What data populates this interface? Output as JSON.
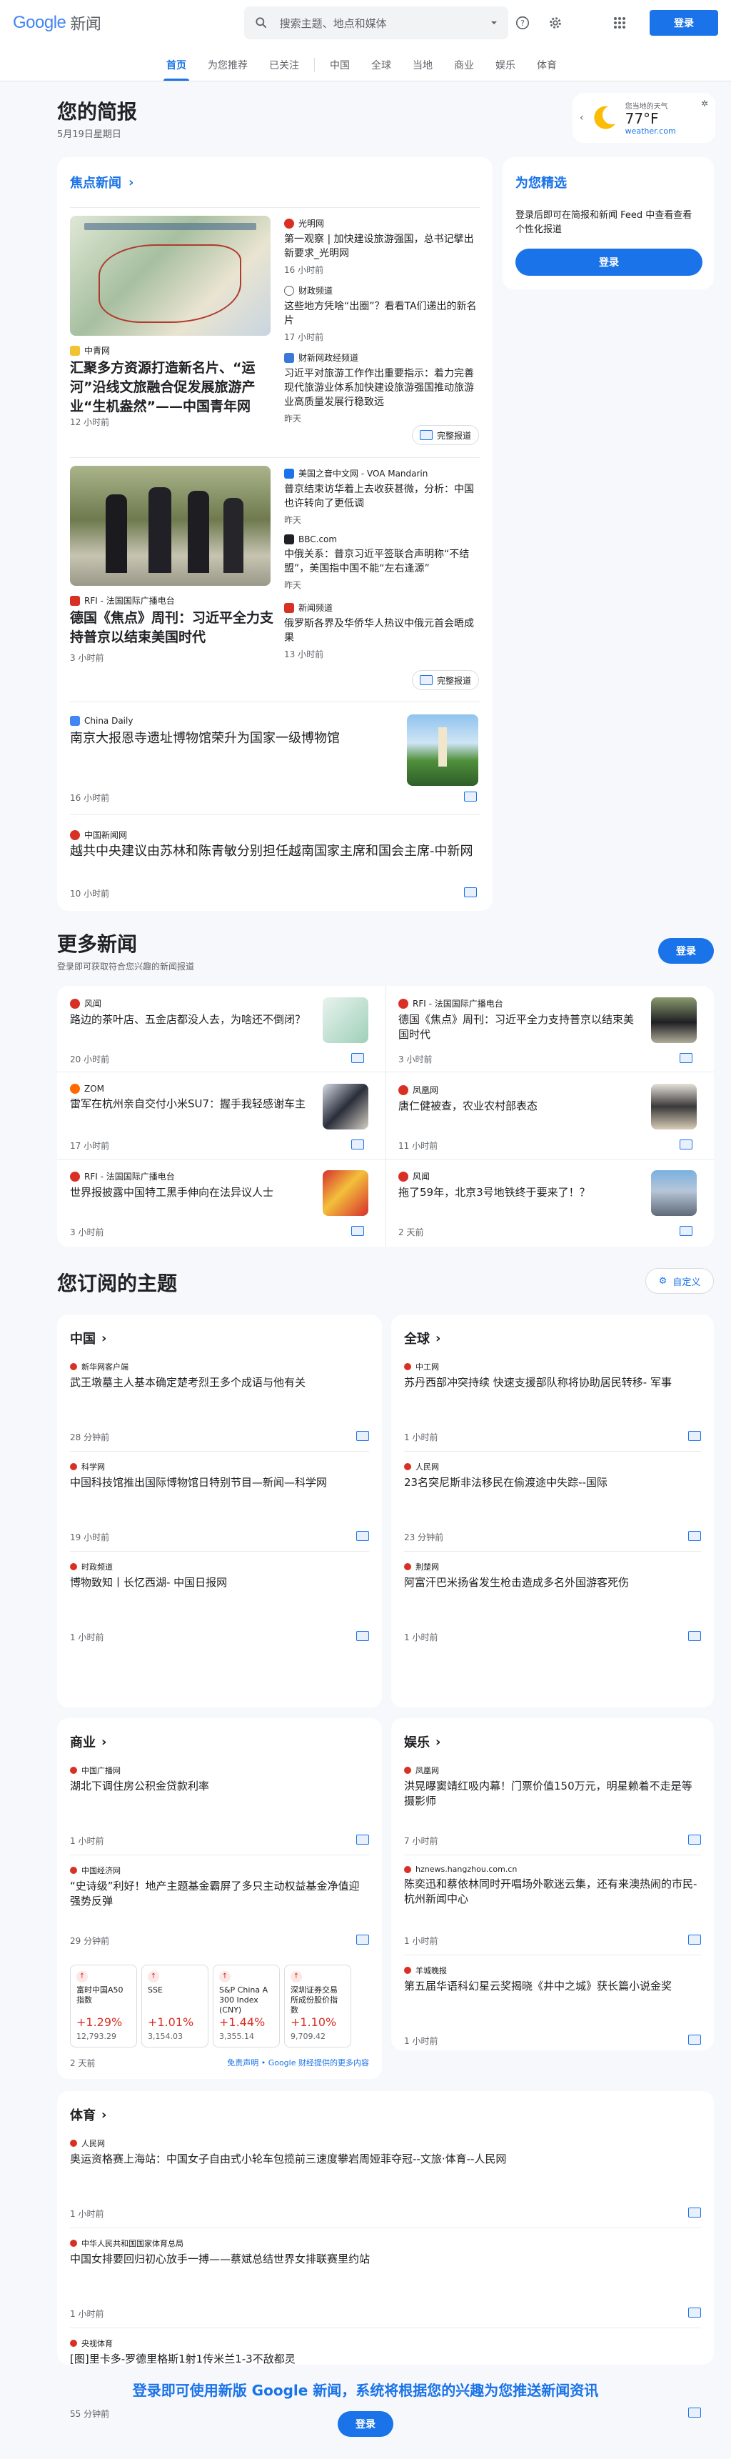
{
  "header": {
    "logo_google": "Google",
    "logo_news": "新闻",
    "search_placeholder": "搜索主题、地点和媒体",
    "signin": "登录"
  },
  "nav": {
    "tabs": [
      "首页",
      "为您推荐",
      "已关注",
      "中国",
      "全球",
      "当地",
      "商业",
      "娱乐",
      "体育"
    ]
  },
  "briefing": {
    "title": "您的简报",
    "date": "5月19日星期日",
    "weather_label": "您当地的天气",
    "temp": "77°F",
    "weather_source": "weather.com"
  },
  "headlines": {
    "title": "焦点新闻",
    "full_coverage": "完整报道",
    "cluster1": {
      "main_source": "中青网",
      "main_title": "汇聚多方资源打造新名片、“运河”沿线文旅融合促发展旅游产业“生机盎然”——中国青年网",
      "main_time": "12 小时前",
      "side": [
        {
          "source": "光明网",
          "title": "第一观察 | 加快建设旅游强国，总书记擘出新要求_光明网",
          "time": "16 小时前"
        },
        {
          "source": "财政频道",
          "title": "这些地方凭啥“出圈”？看看TA们递出的新名片",
          "time": "17 小时前"
        },
        {
          "source": "财新网政经频道",
          "title": "习近平对旅游工作作出重要指示：着力完善现代旅游业体系加快建设旅游强国推动旅游业高质量发展行稳致远",
          "time": "昨天"
        }
      ]
    },
    "cluster2": {
      "main_source": "RFI - 法国国际广播电台",
      "main_title": "德国《焦点》周刊：习近平全力支持普京以结束美国时代",
      "main_time": "3 小时前",
      "side": [
        {
          "source": "美国之音中文网 - VOA Mandarin",
          "title": "普京结束访华着上去收获甚微，分析：中国也许转向了更低调",
          "time": "昨天"
        },
        {
          "source": "BBC.com",
          "title": "中俄关系：普京习近平签联合声明称“不结盟”，美国指中国不能“左右逢源”",
          "time": "昨天"
        },
        {
          "source": "新闻频道",
          "title": "俄罗斯各界及华侨华人热议中俄元首会晤成果",
          "time": "13 小时前"
        }
      ]
    },
    "single1": {
      "source": "China Daily",
      "title": "南京大报恩寺遗址博物馆荣升为国家一级博物馆",
      "time": "16 小时前"
    },
    "single2": {
      "source": "中国新闻网",
      "title": "越共中央建议由苏林和陈青敏分别担任越南国家主席和国会主席-中新网",
      "time": "10 小时前"
    }
  },
  "for_you": {
    "title": "为您精选",
    "desc": "登录后即可在简报和新闻 Feed 中查看查看个性化报道",
    "signin": "登录"
  },
  "more": {
    "title": "更多新闻",
    "desc": "登录即可获取符合您兴趣的新闻报道",
    "signin": "登录",
    "items": [
      {
        "source": "风闻",
        "title": "路边的茶叶店、五金店都没人去，为啥还不倒闭？",
        "time": "20 小时前"
      },
      {
        "source": "RFI - 法国国际广播电台",
        "title": "德国《焦点》周刊：习近平全力支持普京以结束美国时代",
        "time": "3 小时前"
      },
      {
        "source": "ZOM",
        "title": "雷军在杭州亲自交付小米SU7：握手我轻感谢车主",
        "time": "17 小时前"
      },
      {
        "source": "凤凰网",
        "title": "唐仁健被查，农业农村部表态",
        "time": "11 小时前"
      },
      {
        "source": "RFI - 法国国际广播电台",
        "title": "世界报披露中国特工黑手伸向在法异议人士",
        "time": "3 小时前"
      },
      {
        "source": "风闻",
        "title": "拖了59年，北京3号地铁终于要来了！？",
        "time": "2 天前"
      }
    ]
  },
  "topics": {
    "title": "您订阅的主题",
    "customize": "自定义",
    "china": {
      "title": "中国",
      "stories": [
        {
          "source": "新华网客户端",
          "title": "武王墩墓主人基本确定楚考烈王多个成语与他有关",
          "time": "28 分钟前"
        },
        {
          "source": "科学网",
          "title": "中国科技馆推出国际博物馆日特别节目—新闻—科学网",
          "time": "19 小时前"
        },
        {
          "source": "时政频道",
          "title": "博物致知丨长忆西湖- 中国日报网",
          "time": "1 小时前"
        }
      ]
    },
    "global": {
      "title": "全球",
      "stories": [
        {
          "source": "中工网",
          "title": "苏丹西部冲突持续 快速支援部队称将协助居民转移- 军事",
          "time": "1 小时前"
        },
        {
          "source": "人民网",
          "title": "23名突尼斯非法移民在偷渡途中失踪--国际",
          "time": "23 分钟前"
        },
        {
          "source": "荆楚网",
          "title": "阿富汗巴米扬省发生枪击造成多名外国游客死伤",
          "time": "1 小时前"
        }
      ]
    },
    "business": {
      "title": "商业",
      "stories": [
        {
          "source": "中国广播网",
          "title": "湖北下调住房公积金贷款利率",
          "time": "1 小时前"
        },
        {
          "source": "中国经济网",
          "title": "“史诗级”利好！地产主题基金霸屏了多只主动权益基金净值迎强势反弹",
          "time": "29 分钟前"
        }
      ],
      "stocks": [
        {
          "name": "富时中国A50指数",
          "pct": "+1.29%",
          "val": "12,793.29"
        },
        {
          "name": "SSE",
          "pct": "+1.01%",
          "val": "3,154.03"
        },
        {
          "name": "S&P China A 300 Index (CNY)",
          "pct": "+1.44%",
          "val": "3,355.14"
        },
        {
          "name": "深圳证券交易所成份股价指数",
          "pct": "+1.10%",
          "val": "9,709.42"
        }
      ],
      "stock_time": "2 天前",
      "disclaimer": "免责声明 • Google 财经提供的更多内容"
    },
    "ent": {
      "title": "娱乐",
      "stories": [
        {
          "source": "凤凰网",
          "title": "洪晃曝窦靖红吸内幕！门票价值150万元，明星赖着不走是等摄影师",
          "time": "7 小时前"
        },
        {
          "source": "hznews.hangzhou.com.cn",
          "title": "陈奕迅和蔡依林同时开唱场外歌迷云集，还有来澳热闹的市民- 杭州新闻中心",
          "time": "1 小时前"
        },
        {
          "source": "羊城晚报",
          "title": "第五届华语科幻星云奖揭晓《井中之城》获长篇小说金奖",
          "time": "1 小时前"
        }
      ]
    },
    "sports": {
      "title": "体育",
      "stories": [
        {
          "source": "人民网",
          "title": "奥运资格赛上海站：中国女子自由式小轮车包揽前三速度攀岩周娅菲夺冠--文旅·体育--人民网",
          "time": "1 小时前"
        },
        {
          "source": "中华人民共和国国家体育总局",
          "title": "中国女排要回归初心放手一搏——蔡斌总结世界女排联赛里约站",
          "time": "1 小时前"
        },
        {
          "source": "央视体育",
          "title": "[图]里卡多-罗德里格斯1射1传米兰1-3不敌都灵",
          "time": "55 分钟前"
        }
      ]
    }
  },
  "footer": {
    "text": "登录即可使用新版 Google 新闻，系统将根据您的兴趣为您推送新闻资讯",
    "signin": "登录"
  }
}
